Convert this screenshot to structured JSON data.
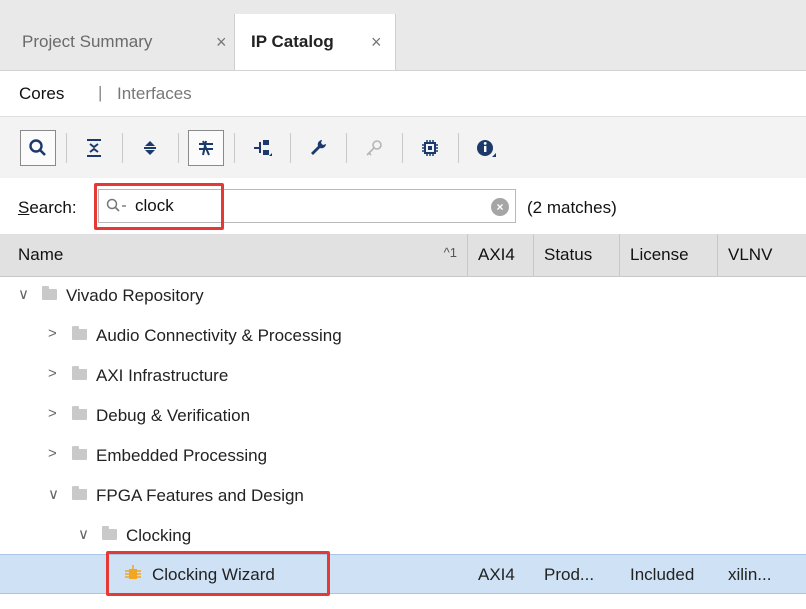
{
  "tabs": [
    {
      "label": "Project Summary",
      "close": "×"
    },
    {
      "label": "IP Catalog",
      "close": "×"
    }
  ],
  "subtabs": {
    "cores": "Cores",
    "separator": "|",
    "interfaces": "Interfaces"
  },
  "toolbar": {
    "icons": [
      "search-icon",
      "collapse-all-icon",
      "expand-all-icon",
      "filter-icon",
      "hierarchy-icon",
      "wrench-icon",
      "key-icon",
      "chip-icon",
      "info-icon"
    ]
  },
  "search": {
    "label_prefix": "S",
    "label_rest": "earch:",
    "value": "clock",
    "placeholder": "",
    "clear": "×",
    "matches": "(2 matches)"
  },
  "table": {
    "columns": [
      "Name",
      "AXI4",
      "Status",
      "License",
      "VLNV"
    ],
    "sort_indicator": "^1",
    "rows": [
      {
        "label": "Vivado Repository",
        "expanded": true,
        "chevron": "∨"
      },
      {
        "label": "Audio Connectivity & Processing",
        "chevron": ">"
      },
      {
        "label": "AXI Infrastructure",
        "chevron": ">"
      },
      {
        "label": "Debug & Verification",
        "chevron": ">"
      },
      {
        "label": "Embedded Processing",
        "chevron": ">"
      },
      {
        "label": "FPGA Features and Design",
        "expanded": true,
        "chevron": "∨"
      },
      {
        "label": "Clocking",
        "expanded": true,
        "chevron": "∨"
      },
      {
        "label": "Clocking Wizard",
        "axi4": "AXI4",
        "status": "Prod...",
        "license": "Included",
        "vlnv": "xilin..."
      }
    ]
  },
  "colors": {
    "highlight": "#e53935",
    "selection": "#cfe1f5"
  }
}
